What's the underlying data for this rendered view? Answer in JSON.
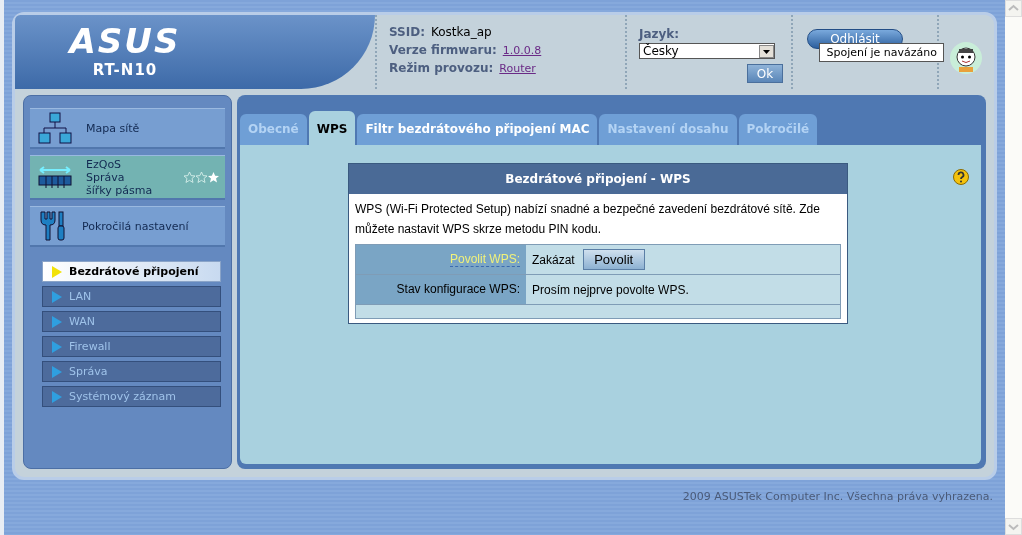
{
  "header": {
    "logo": "ASUS",
    "model": "RT-N10",
    "info": [
      {
        "label": "SSID:",
        "value": "Kostka_ap",
        "link": false
      },
      {
        "label": "Verze firmwaru:",
        "value": "1.0.0.8",
        "link": true
      },
      {
        "label": "Režim provozu:",
        "value": "Router",
        "link": true
      }
    ],
    "language": {
      "label": "Jazyk:",
      "value": "Česky",
      "button": "Ok"
    },
    "logout_button": "Odhlásit",
    "tooltip": "Spojení je navázáno"
  },
  "sidebar": {
    "items": [
      {
        "label": "Mapa sítě",
        "kind": "map",
        "highlighted": false
      },
      {
        "label": "EzQoS\nSpráva\nšířky pásma",
        "kind": "qos",
        "highlighted": true,
        "stars": 1
      },
      {
        "label": "Pokročilá nastavení",
        "kind": "tools",
        "highlighted": false
      }
    ],
    "submenu": [
      {
        "label": "Bezdrátové připojení",
        "selected": true
      },
      {
        "label": "LAN",
        "selected": false
      },
      {
        "label": "WAN",
        "selected": false
      },
      {
        "label": "Firewall",
        "selected": false
      },
      {
        "label": "Správa",
        "selected": false
      },
      {
        "label": "Systémový záznam",
        "selected": false
      }
    ]
  },
  "tabs": [
    {
      "label": "Obecné",
      "selected": false,
      "bright": false
    },
    {
      "label": "WPS",
      "selected": true,
      "bright": false
    },
    {
      "label": "Filtr bezdrátového připojení MAC",
      "selected": false,
      "bright": true
    },
    {
      "label": "Nastavení dosahu",
      "selected": false,
      "bright": false
    },
    {
      "label": "Pokročilé",
      "selected": false,
      "bright": false
    }
  ],
  "panel": {
    "title": "Bezdrátové připojení - WPS",
    "description": "WPS (Wi-Fi Protected Setup) nabízí snadné a bezpečné zavedení bezdrátové sítě. Zde můžete nastavit WPS skrze metodu PIN kodu.",
    "rows": [
      {
        "label": "Povolit WPS:",
        "help_link": true,
        "value": "Zakázat",
        "button": "Povolit"
      },
      {
        "label": "Stav konfigurace WPS:",
        "help_link": false,
        "value": "Prosím nejprve povolte WPS."
      }
    ]
  },
  "footer": "2009 ASUSTek Computer Inc. Všechna práva vyhrazena."
}
